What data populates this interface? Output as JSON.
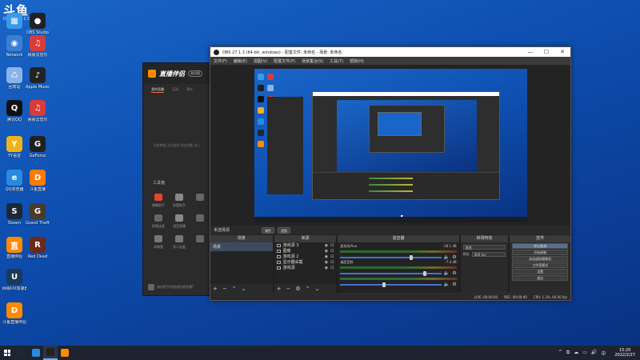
{
  "watermark": {
    "main": "斗鱼",
    "sub": "DOUYU.COM"
  },
  "desktop_icons": [
    {
      "label": "",
      "color": "#3a9ae6",
      "glyph": "▦"
    },
    {
      "label": "OBS Studio",
      "color": "#222222",
      "glyph": "●"
    },
    {
      "label": "Network",
      "color": "#3a7fd4",
      "glyph": "◉"
    },
    {
      "label": "网易云音乐",
      "color": "#d93a3a",
      "glyph": "♫"
    },
    {
      "label": "回收站",
      "color": "#8ab4e8",
      "glyph": "♺"
    },
    {
      "label": "Apple Music",
      "color": "#222222",
      "glyph": "♪"
    },
    {
      "label": "腾讯QQ",
      "color": "#111111",
      "glyph": "Q"
    },
    {
      "label": "网易云音乐",
      "color": "#d93a3a",
      "glyph": "♫"
    },
    {
      "label": "YY语音",
      "color": "#f0b21a",
      "glyph": "Y"
    },
    {
      "label": "GeForce",
      "color": "#202020",
      "glyph": "G"
    },
    {
      "label": "QQ浏览器",
      "color": "#2a8ae0",
      "glyph": "e"
    },
    {
      "label": "斗鱼直播",
      "color": "#ff7a00",
      "glyph": "D"
    },
    {
      "label": "Steam",
      "color": "#1b2838",
      "glyph": "S"
    },
    {
      "label": "Grand Theft Auto",
      "color": "#4a3a2a",
      "glyph": "G"
    },
    {
      "label": "直播伴侣",
      "color": "#ff8a00",
      "glyph": "直"
    },
    {
      "label": "Red Dead",
      "color": "#6a2a1a",
      "glyph": "R"
    },
    {
      "label": "网易UU加速器",
      "color": "#1a3a5a",
      "glyph": "U"
    },
    {
      "label": "斗鱼直播伴侣",
      "color": "#ff8a00",
      "glyph": "D"
    }
  ],
  "zb_app": {
    "title": "直播伴侣",
    "badge": "测试版",
    "tabs": [
      "我的直播",
      "互动",
      "观众"
    ],
    "empty_text": "没有数据 点击该处添加直播 进入",
    "tools_title": "工具箱",
    "tools": [
      {
        "label": "弹幕助手",
        "color": "#e0452f"
      },
      {
        "label": "房管助手",
        "color": "#888888"
      },
      {
        "label": "",
        "color": "#666666"
      },
      {
        "label": "视频连麦",
        "color": "#666666"
      },
      {
        "label": "语音直播",
        "color": "#888888"
      },
      {
        "label": "",
        "color": "#666666"
      },
      {
        "label": "录像管",
        "color": "#777777"
      },
      {
        "label": "多人连麦",
        "color": "#777777"
      },
      {
        "label": "",
        "color": "#666666"
      }
    ],
    "footer_text": "如何把手机游戏投屏直播?"
  },
  "obs": {
    "title": "OBS 27.1.3 (64-bit, windows) - 配置文件: 未命名 - 场景: 未命名",
    "window_buttons": [
      "—",
      "☐",
      "✕"
    ],
    "menu": [
      "文件(F)",
      "编辑(E)",
      "视图(V)",
      "配置文件(P)",
      "场景集合(S)",
      "工具(T)",
      "帮助(H)"
    ],
    "source_toolbar": {
      "label": "未选择源",
      "props_button": "属性",
      "filter_button": "滤镜"
    },
    "docks": {
      "scenes": {
        "title": "场景",
        "items": [
          "场景"
        ]
      },
      "sources": {
        "title": "来源",
        "items": [
          {
            "name": "游戏源 3"
          },
          {
            "name": "图像"
          },
          {
            "name": "游戏源 2"
          },
          {
            "name": "显示器采集"
          },
          {
            "name": "游戏源"
          }
        ]
      },
      "mixer": {
        "title": "混音器",
        "channels": [
          {
            "name": "麦克风/Aux",
            "db": "-18.1 dB",
            "level": 0.72
          },
          {
            "name": "桌面音频",
            "db": "-7.4 dB",
            "level": 0.85
          },
          {
            "name": "",
            "db": "",
            "level": 0.45
          }
        ]
      },
      "transitions": {
        "title": "转场特效",
        "type": "渐变",
        "duration_label": "时长",
        "duration": "300 ms"
      },
      "controls": {
        "title": "控件",
        "buttons": [
          "停止推流",
          "开始录制",
          "启动虚拟摄像机",
          "工作室模式",
          "设置",
          "退出"
        ],
        "active_index": 0
      }
    },
    "status": {
      "live_label": "LIVE:",
      "live_time": "00:00:00",
      "rec_label": "REC:",
      "rec_time": "00:00:00",
      "cpu": "CPU: 1.3%, 60.00 fps"
    }
  },
  "taskbar": {
    "apps": [
      {
        "name": "steam",
        "color": "#1b2838"
      },
      {
        "name": "edge",
        "color": "#2a8ae0"
      },
      {
        "name": "obs",
        "color": "#222222"
      },
      {
        "name": "zbhelper",
        "color": "#ff8a00"
      }
    ],
    "tray_icons": [
      "^",
      "⧉",
      "☁",
      "▭",
      "🔊",
      "中"
    ],
    "time": "15:20",
    "date": "2022/2/27"
  }
}
